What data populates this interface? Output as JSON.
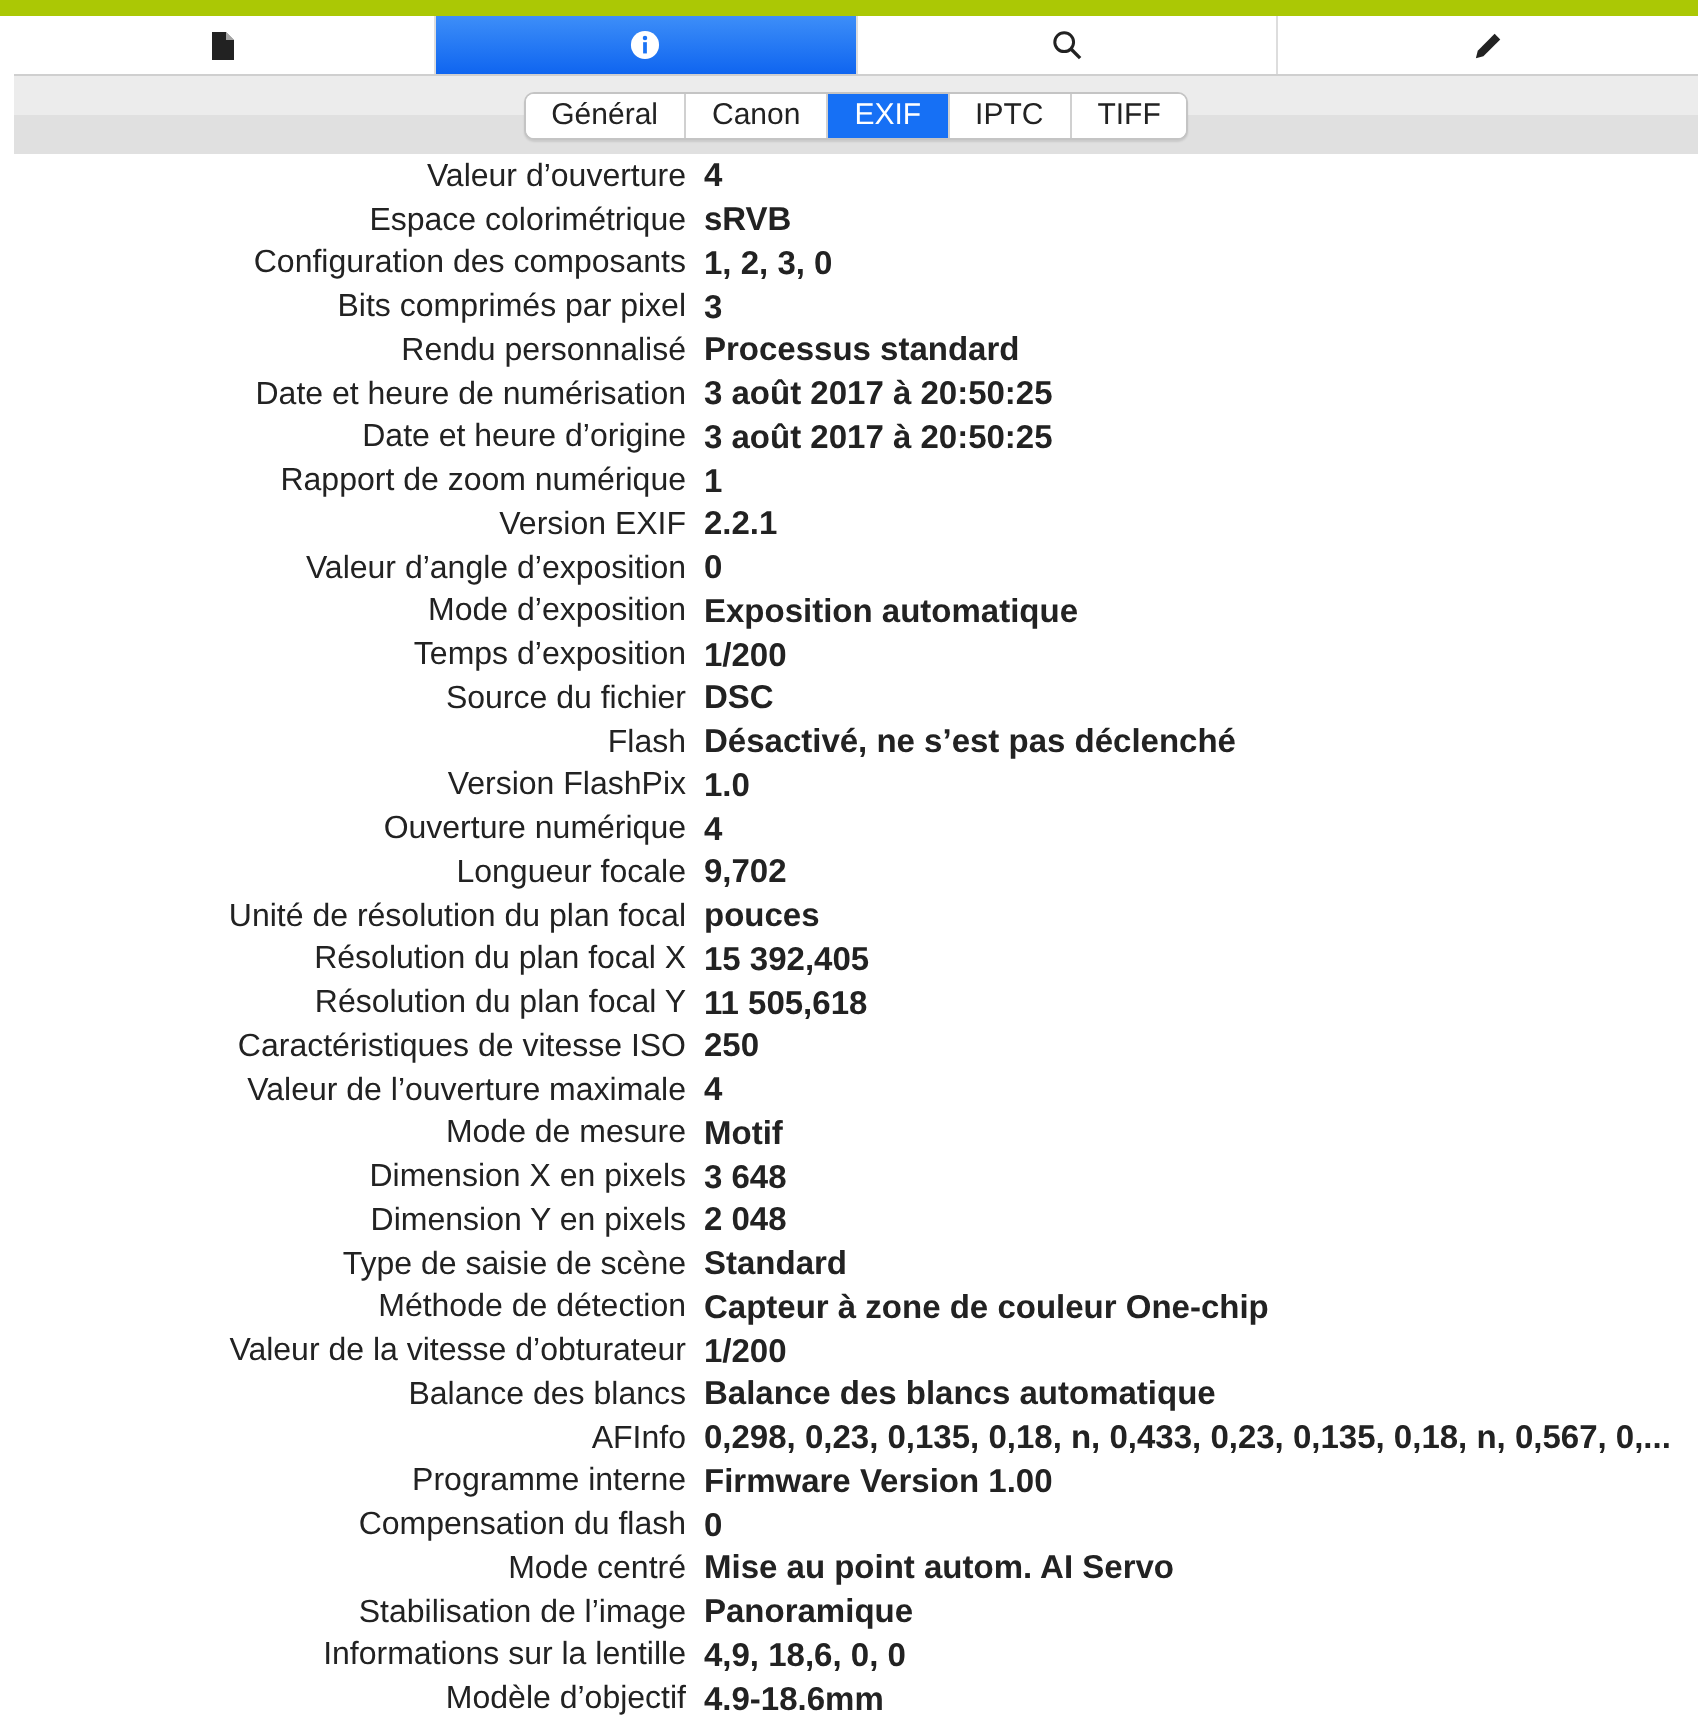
{
  "toolbar": [
    {
      "kind": "document",
      "selected": false
    },
    {
      "kind": "info",
      "selected": true
    },
    {
      "kind": "search",
      "selected": false
    },
    {
      "kind": "pencil",
      "selected": false
    }
  ],
  "tabs": [
    {
      "label": "Général",
      "selected": false
    },
    {
      "label": "Canon",
      "selected": false
    },
    {
      "label": "EXIF",
      "selected": true
    },
    {
      "label": "IPTC",
      "selected": false
    },
    {
      "label": "TIFF",
      "selected": false
    }
  ],
  "rows": [
    {
      "label": "Valeur d’ouverture",
      "value": "4"
    },
    {
      "label": "Espace colorimétrique",
      "value": "sRVB"
    },
    {
      "label": "Configuration des composants",
      "value": "1, 2, 3, 0"
    },
    {
      "label": "Bits comprimés par pixel",
      "value": "3"
    },
    {
      "label": "Rendu personnalisé",
      "value": "Processus standard"
    },
    {
      "label": "Date et heure de numérisation",
      "value": "3 août 2017 à 20:50:25"
    },
    {
      "label": "Date et heure d’origine",
      "value": "3 août 2017 à 20:50:25"
    },
    {
      "label": "Rapport de zoom numérique",
      "value": "1"
    },
    {
      "label": "Version EXIF",
      "value": "2.2.1"
    },
    {
      "label": "Valeur d’angle d’exposition",
      "value": "0"
    },
    {
      "label": "Mode d’exposition",
      "value": "Exposition automatique"
    },
    {
      "label": "Temps d’exposition",
      "value": "1/200"
    },
    {
      "label": "Source du fichier",
      "value": "DSC"
    },
    {
      "label": "Flash",
      "value": "Désactivé, ne s’est pas déclenché"
    },
    {
      "label": "Version FlashPix",
      "value": "1.0"
    },
    {
      "label": "Ouverture numérique",
      "value": "4"
    },
    {
      "label": "Longueur focale",
      "value": "9,702"
    },
    {
      "label": "Unité de résolution du plan focal",
      "value": "pouces"
    },
    {
      "label": "Résolution du plan focal X",
      "value": "15 392,405"
    },
    {
      "label": "Résolution du plan focal Y",
      "value": "11 505,618"
    },
    {
      "label": "Caractéristiques de vitesse ISO",
      "value": "250"
    },
    {
      "label": "Valeur de l’ouverture maximale",
      "value": "4"
    },
    {
      "label": "Mode de mesure",
      "value": "Motif"
    },
    {
      "label": "Dimension X en pixels",
      "value": "3 648"
    },
    {
      "label": "Dimension Y en pixels",
      "value": "2 048"
    },
    {
      "label": "Type de saisie de scène",
      "value": "Standard"
    },
    {
      "label": "Méthode de détection",
      "value": "Capteur à zone de couleur One-chip"
    },
    {
      "label": "Valeur de la vitesse d’obturateur",
      "value": "1/200"
    },
    {
      "label": "Balance des blancs",
      "value": "Balance des blancs automatique"
    },
    {
      "label": "AFInfo",
      "value": "0,298, 0,23, 0,135, 0,18, n, 0,433, 0,23, 0,135, 0,18, n, 0,567, 0,..."
    },
    {
      "label": "Programme interne",
      "value": "Firmware Version 1.00"
    },
    {
      "label": "Compensation du flash",
      "value": "0"
    },
    {
      "label": "Mode centré",
      "value": "Mise au point autom. AI Servo"
    },
    {
      "label": "Stabilisation de l’image",
      "value": "Panoramique"
    },
    {
      "label": "Informations sur la lentille",
      "value": "4,9, 18,6, 0, 0"
    },
    {
      "label": "Modèle d’objectif",
      "value": "4.9-18.6mm"
    }
  ]
}
